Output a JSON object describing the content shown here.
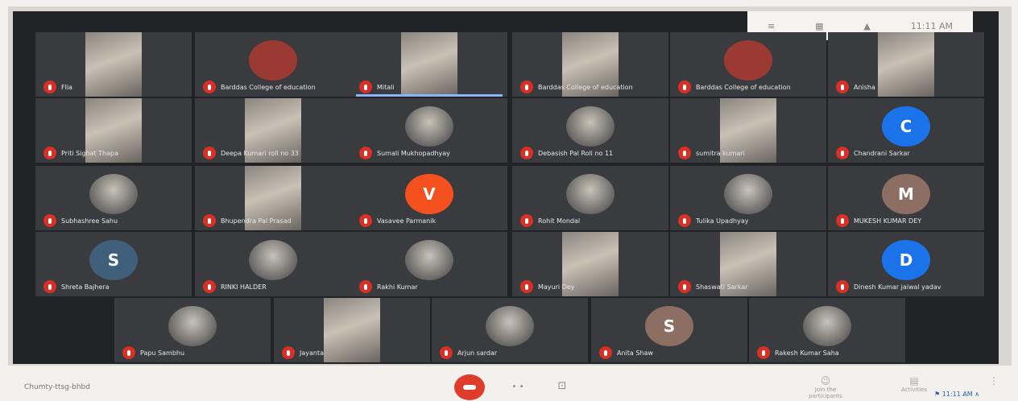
{
  "topbar": {
    "items": [
      "≡",
      "▦",
      "▲",
      "11:11 AM"
    ]
  },
  "tiles": [
    {
      "name": "Flia",
      "kind": "video"
    },
    {
      "name": "Barddas College of education",
      "kind": "avatar",
      "color": "#9b3a32",
      "initial": ""
    },
    {
      "name": "Mitali",
      "kind": "video",
      "presenting": true
    },
    {
      "name": "Barddas College of education",
      "kind": "video"
    },
    {
      "name": "Barddas College of education",
      "kind": "avatar",
      "color": "#9b3a32",
      "initial": ""
    },
    {
      "name": "Anisha",
      "kind": "video"
    },
    {
      "name": "Priti Sighat Thapa",
      "kind": "video"
    },
    {
      "name": "Deepa Kumari roll no 33",
      "kind": "video"
    },
    {
      "name": "Sumali Mukhopadhyay",
      "kind": "photo"
    },
    {
      "name": "Debasish Pal Roll no 11",
      "kind": "photo"
    },
    {
      "name": "sumitra kumari",
      "kind": "video"
    },
    {
      "name": "Chandrani Sarkar",
      "kind": "avatar",
      "color": "#1a73e8",
      "initial": "C"
    },
    {
      "name": "Subhashree Sahu",
      "kind": "photo"
    },
    {
      "name": "Bhupendra Pal Prasad",
      "kind": "video"
    },
    {
      "name": "Vasavee Parmanik",
      "kind": "avatar",
      "color": "#f4511e",
      "initial": "V"
    },
    {
      "name": "Rohit Mondal",
      "kind": "photo"
    },
    {
      "name": "Tulika Upadhyay",
      "kind": "photo"
    },
    {
      "name": "MUKESH KUMAR DEY",
      "kind": "avatar",
      "color": "#8d6e63",
      "initial": "M"
    },
    {
      "name": "Shreta Bajhera",
      "kind": "avatar",
      "color": "#3f5f7a",
      "initial": "S"
    },
    {
      "name": "RINKI HALDER",
      "kind": "photo"
    },
    {
      "name": "Rakhi Kumar",
      "kind": "photo"
    },
    {
      "name": "Mayuri Dey",
      "kind": "video"
    },
    {
      "name": "Shaswati Sarkar",
      "kind": "video"
    },
    {
      "name": "Dinesh Kumar jaiwal yadav",
      "kind": "avatar",
      "color": "#1a73e8",
      "initial": "D"
    },
    {
      "name": "Papu Sambhu",
      "kind": "photo"
    },
    {
      "name": "Jayanta",
      "kind": "video"
    },
    {
      "name": "Arjun sardar",
      "kind": "photo"
    },
    {
      "name": "Anita Shaw",
      "kind": "avatar",
      "color": "#8d6e63",
      "initial": "S"
    },
    {
      "name": "Rakesh Kumar Saha",
      "kind": "photo"
    }
  ],
  "bottombar": {
    "meeting_code": "Chumty-ttsg-bhbd",
    "cc_label": "• •",
    "present_label": "⊡",
    "participants_label": "Join the participants",
    "chat_label": "Activities",
    "more_label": "⋮",
    "tray_text": "⚑ 11:11 AM ∧"
  },
  "colors": {
    "background": "#222326",
    "tile": "#3a3b3f",
    "mic_off": "#d93025",
    "hangup": "#e03c2c",
    "presenting": "#8ab4f8"
  }
}
